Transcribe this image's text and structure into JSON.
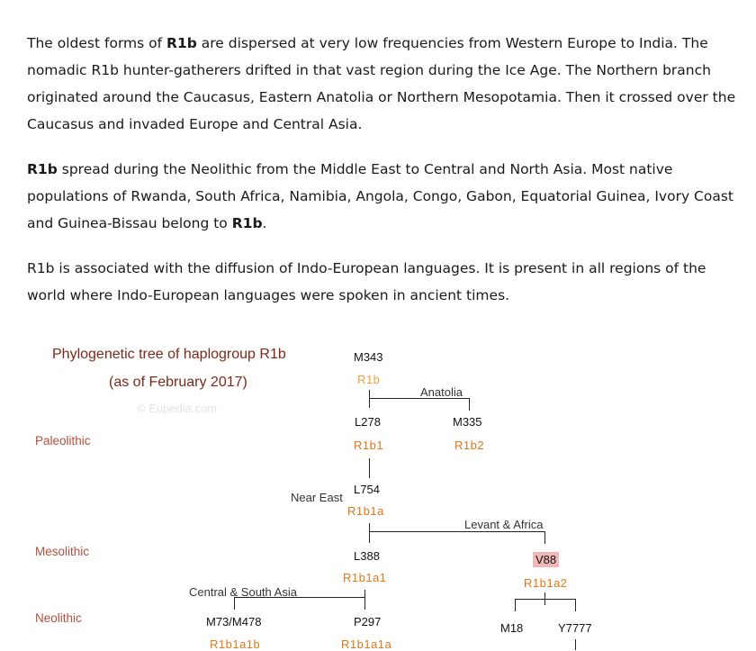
{
  "paragraphs": [
    {
      "bold_term": "R1b",
      "p1_pre": "The oldest forms of ",
      "p1_post": " are dispersed at very low frequencies from Western Europe to India. The nomadic R1b hunter-gatherers drifted in that vast region during the Ice Age. The Northern branch originated around the Caucasus, Eastern Anatolia or Northern Mesopotamia. Then it crossed over the Caucasus and invaded Europe and Central Asia."
    },
    {
      "p2_post_a": " spread during the Neolithic from the Middle East to Central and North Asia. Most native populations of Rwanda, South Africa, Namibia, Angola, Congo, Gabon, Equatorial Guinea, Ivory Coast and Guinea-Bissau belong to ",
      "p2_post_b": "."
    },
    {
      "p3": "R1b is associated with the diffusion of Indo-European languages. It is present in all regions of the world where Indo-European languages were spoken in ancient times."
    }
  ],
  "tree": {
    "title_line1": "Phylogenetic tree of haplogroup R1b",
    "title_line2": "(as of February 2017)",
    "watermark": "© Eupedia.com",
    "eras": {
      "paleolithic": "Paleolithic",
      "mesolithic": "Mesolithic",
      "neolithic": "Neolithic"
    },
    "regions": {
      "anatolia": "Anatolia",
      "near_east": "Near East",
      "levant_africa": "Levant & Africa",
      "central_south_asia": "Central & South Asia"
    },
    "nodes": {
      "m343": {
        "snp": "M343",
        "hg": "R1b"
      },
      "l278": {
        "snp": "L278",
        "hg": "R1b1"
      },
      "m335": {
        "snp": "M335",
        "hg": "R1b2"
      },
      "l754": {
        "snp": "L754",
        "hg": "R1b1a"
      },
      "l388": {
        "snp": "L388",
        "hg": "R1b1a1"
      },
      "v88": {
        "snp": "V88",
        "hg": "R1b1a2"
      },
      "m73": {
        "snp": "M73/M478",
        "hg": "R1b1a1b"
      },
      "p297": {
        "snp": "P297",
        "hg": "R1b1a1a"
      },
      "m18": {
        "snp": "M18"
      },
      "y7777": {
        "snp": "Y7777"
      }
    }
  }
}
